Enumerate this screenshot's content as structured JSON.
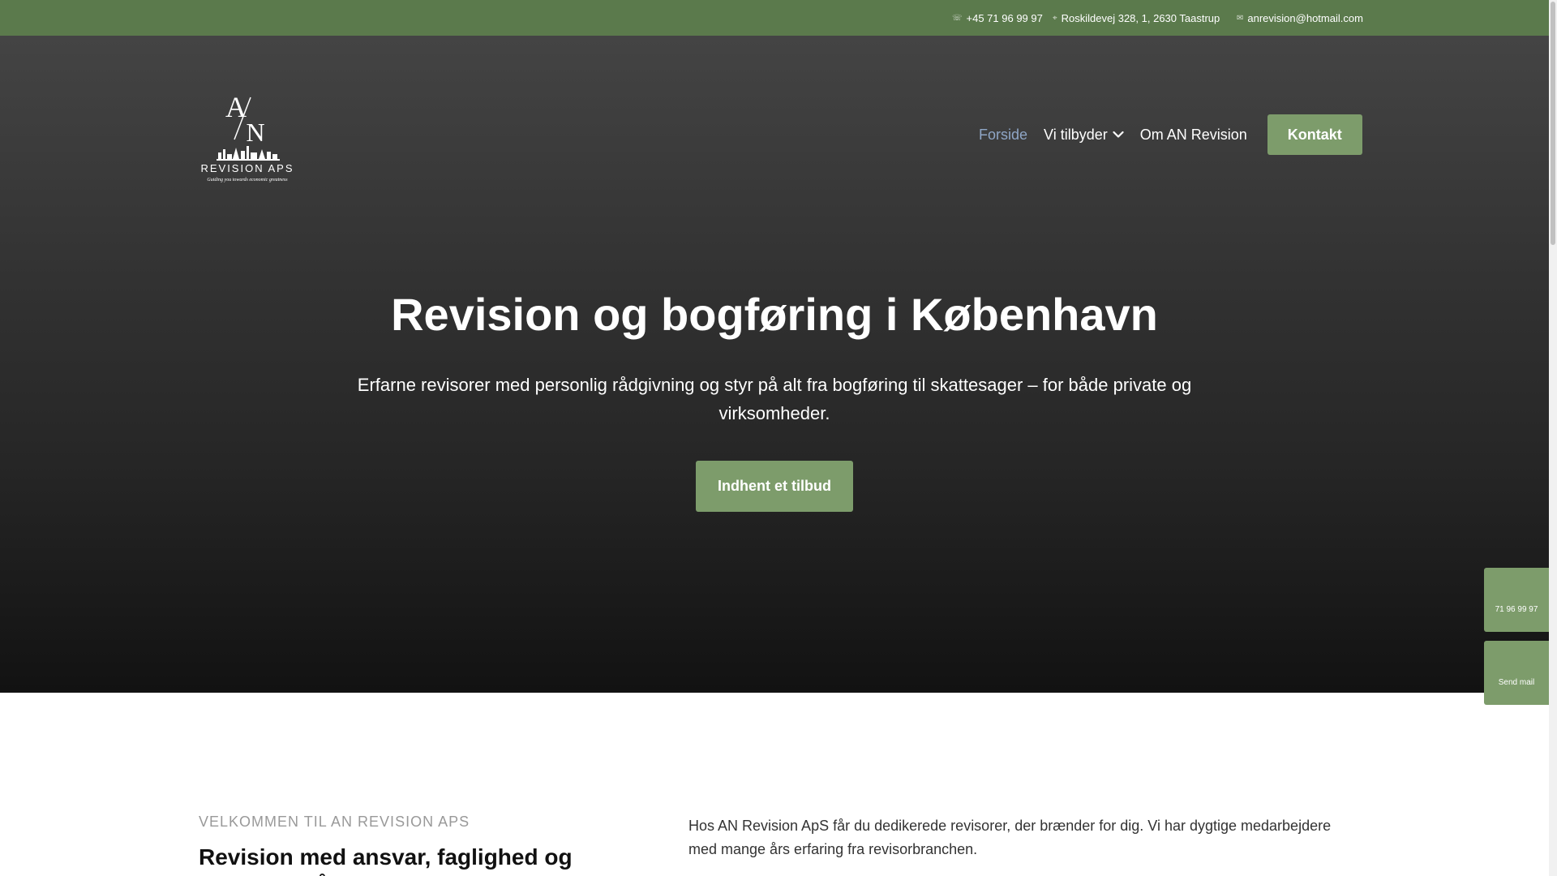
{
  "topbar": {
    "phone": "+45 71 96 99 97",
    "address": "Roskildevej 328, 1, 2630 Taastrup",
    "email": "anrevision@hotmail.com",
    "phone_icon": "phone-icon",
    "address_icon": "map-pin-icon",
    "email_icon": "envelope-icon"
  },
  "logo": {
    "initials_a": "A",
    "initials_n": "N",
    "name": "REVISION APS",
    "tagline": "Guiding you towards economic greatness"
  },
  "nav": {
    "items": [
      {
        "label": "Forside",
        "active": true
      },
      {
        "label": "Vi tilbyder",
        "has_dropdown": true
      },
      {
        "label": "Om AN Revision"
      }
    ],
    "cta": "Kontakt"
  },
  "hero": {
    "title": "Revision og bogføring i København",
    "subtitle": "Erfarne revisorer med personlig rådgivning og styr på alt fra bogføring til skattesager – for både private og virksomheder.",
    "button": "Indhent et tilbud"
  },
  "side_widgets": {
    "phone": "71 96 99 97",
    "mail": "Send mail"
  },
  "welcome": {
    "eyebrow": "VELKOMMEN TIL AN REVISION APS",
    "title": "Revision med ansvar, faglighed og personlig rådgivning",
    "intro": "Hos AN Revision ApS får du dedikerede revisorer, der brænder for dig. Vi har dygtige medarbejdere med mange års erfaring fra revisorbranchen."
  },
  "colors": {
    "topbar": "#5b7a4c",
    "accent": "#7d9c6b",
    "nav_active": "#8fa6c6"
  }
}
